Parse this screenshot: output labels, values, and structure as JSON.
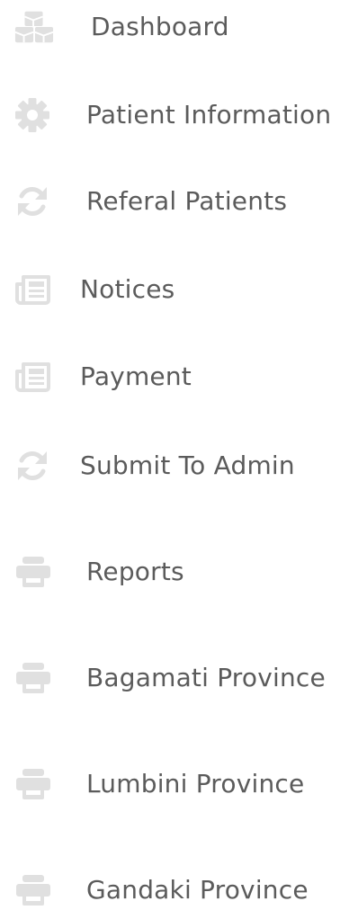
{
  "sidebar": {
    "icon_color": "#e0e0e0",
    "text_color": "#5b5b5b",
    "items": [
      {
        "label": "Dashboard",
        "icon": "cubes-icon"
      },
      {
        "label": "Patient Information",
        "icon": "gear-icon"
      },
      {
        "label": "Referal Patients",
        "icon": "refresh-icon"
      },
      {
        "label": "Notices",
        "icon": "newspaper-icon"
      },
      {
        "label": "Payment",
        "icon": "newspaper-icon"
      },
      {
        "label": "Submit To Admin",
        "icon": "refresh-icon"
      },
      {
        "label": "Reports",
        "icon": "printer-icon"
      },
      {
        "label": "Bagamati Province",
        "icon": "printer-icon"
      },
      {
        "label": "Lumbini Province",
        "icon": "printer-icon"
      },
      {
        "label": "Gandaki Province",
        "icon": "printer-icon"
      }
    ]
  }
}
